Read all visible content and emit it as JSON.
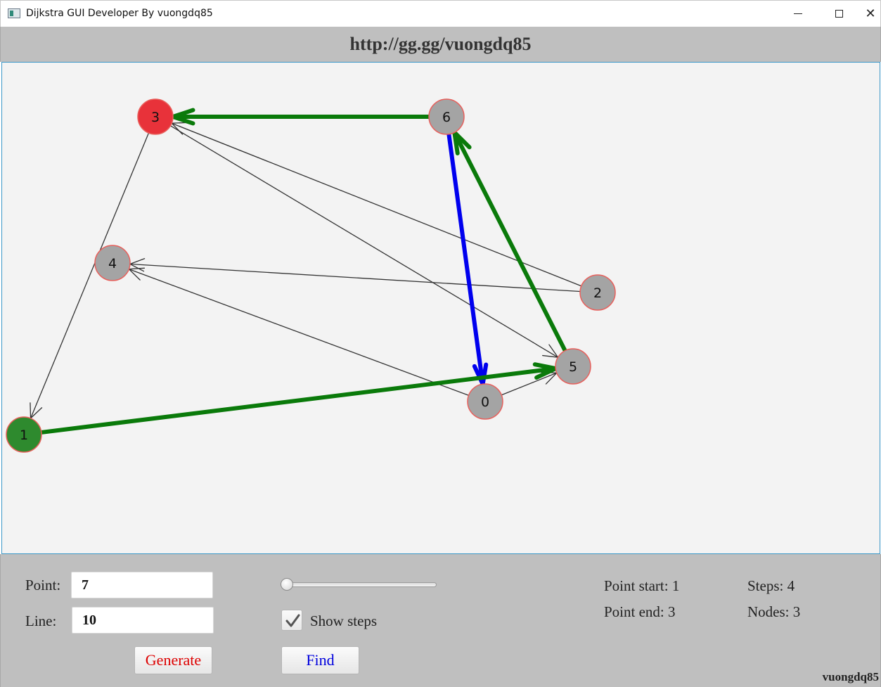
{
  "window": {
    "title": "Dijkstra GUI Developer By vuongdq85",
    "minimize_label": "",
    "maximize_label": "",
    "close_label": "✕"
  },
  "header": {
    "url": "http://gg.gg/vuongdq85"
  },
  "graph": {
    "nodes": [
      {
        "id": "0",
        "label": "0",
        "state": "normal"
      },
      {
        "id": "1",
        "label": "1",
        "state": "start"
      },
      {
        "id": "2",
        "label": "2",
        "state": "normal"
      },
      {
        "id": "3",
        "label": "3",
        "state": "end"
      },
      {
        "id": "4",
        "label": "4",
        "state": "normal"
      },
      {
        "id": "5",
        "label": "5",
        "state": "normal"
      },
      {
        "id": "6",
        "label": "6",
        "state": "normal"
      }
    ],
    "edges": [
      {
        "from": "3",
        "to": "1",
        "style": "normal"
      },
      {
        "from": "3",
        "to": "5",
        "style": "normal"
      },
      {
        "from": "2",
        "to": "3",
        "style": "normal"
      },
      {
        "from": "2",
        "to": "4",
        "style": "normal"
      },
      {
        "from": "0",
        "to": "4",
        "style": "normal"
      },
      {
        "from": "0",
        "to": "5",
        "style": "normal"
      },
      {
        "from": "6",
        "to": "0",
        "style": "current"
      },
      {
        "from": "1",
        "to": "5",
        "style": "path"
      },
      {
        "from": "5",
        "to": "6",
        "style": "path"
      },
      {
        "from": "6",
        "to": "3",
        "style": "path"
      }
    ],
    "colors": {
      "node_fill": "#a4a4a4",
      "node_stroke": "#e8605c",
      "start_fill": "#2e8a2e",
      "end_fill": "#e8323a",
      "edge": "#333333",
      "path_edge": "#0a7a0a",
      "current_edge": "#0000ee",
      "canvas_bg": "#f3f3f3"
    }
  },
  "controls": {
    "point_label": "Point:",
    "point_value": "7",
    "line_label": "Line:",
    "line_value": "10",
    "generate_label": "Generate",
    "generate_color": "#dd0000",
    "find_label": "Find",
    "find_color": "#0000dd",
    "show_steps_label": "Show steps",
    "show_steps_checked": true,
    "speed_slider_value": 0
  },
  "stats": {
    "point_start": "Point start: 1",
    "point_end": "Point end: 3",
    "steps": "Steps: 4",
    "nodes": "Nodes: 3"
  },
  "footer": {
    "brand": "vuongdq85"
  }
}
